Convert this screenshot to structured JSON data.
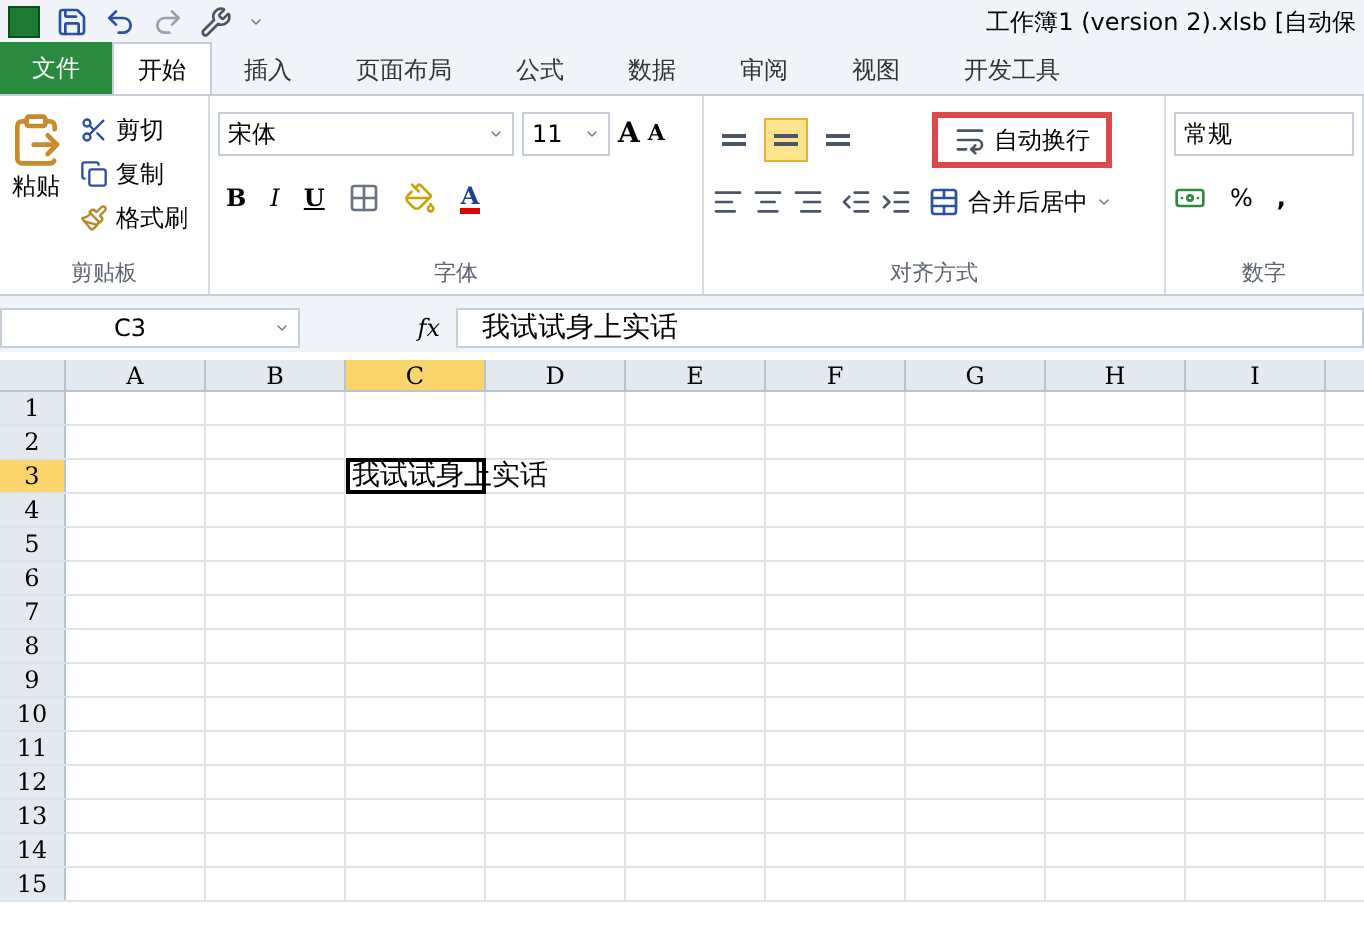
{
  "window": {
    "title": "工作簿1 (version 2).xlsb [自动保"
  },
  "tabs": [
    {
      "label": "文件",
      "kind": "file",
      "selected": false
    },
    {
      "label": "开始",
      "kind": "tab",
      "selected": true
    },
    {
      "label": "插入",
      "kind": "tab",
      "selected": false
    },
    {
      "label": "页面布局",
      "kind": "tab",
      "selected": false
    },
    {
      "label": "公式",
      "kind": "tab",
      "selected": false
    },
    {
      "label": "数据",
      "kind": "tab",
      "selected": false
    },
    {
      "label": "审阅",
      "kind": "tab",
      "selected": false
    },
    {
      "label": "视图",
      "kind": "tab",
      "selected": false
    },
    {
      "label": "开发工具",
      "kind": "tab",
      "selected": false
    }
  ],
  "clipboard": {
    "paste": "粘贴",
    "cut": "剪切",
    "copy": "复制",
    "format_painter": "格式刷",
    "group": "剪贴板"
  },
  "font": {
    "name": "宋体",
    "size": "11",
    "grow": "A",
    "shrink": "A",
    "bold": "B",
    "italic": "I",
    "underline": "U",
    "font_color": "A",
    "group": "字体"
  },
  "alignment": {
    "wrap_text": {
      "label": "自动换行",
      "highlighted": true
    },
    "merge": "合并后居中",
    "vertical": [
      {
        "selected": false
      },
      {
        "selected": true
      },
      {
        "selected": false
      }
    ],
    "group": "对齐方式"
  },
  "number": {
    "format": "常规",
    "percent": "%",
    "comma": ",",
    "group": "数字"
  },
  "formula_bar": {
    "name_box": "C3",
    "fx": "fx",
    "value": "我试试身上实话"
  },
  "sheet": {
    "columns": [
      {
        "label": "A",
        "selected": false
      },
      {
        "label": "B",
        "selected": false
      },
      {
        "label": "C",
        "selected": true
      },
      {
        "label": "D",
        "selected": false
      },
      {
        "label": "E",
        "selected": false
      },
      {
        "label": "F",
        "selected": false
      },
      {
        "label": "G",
        "selected": false
      },
      {
        "label": "H",
        "selected": false
      },
      {
        "label": "I",
        "selected": false
      }
    ],
    "rows": [
      {
        "label": "1",
        "selected": false
      },
      {
        "label": "2",
        "selected": false
      },
      {
        "label": "3",
        "selected": true
      },
      {
        "label": "4",
        "selected": false
      },
      {
        "label": "5",
        "selected": false
      },
      {
        "label": "6",
        "selected": false
      },
      {
        "label": "7",
        "selected": false
      },
      {
        "label": "8",
        "selected": false
      },
      {
        "label": "9",
        "selected": false
      },
      {
        "label": "10",
        "selected": false
      },
      {
        "label": "11",
        "selected": false
      },
      {
        "label": "12",
        "selected": false
      },
      {
        "label": "13",
        "selected": false
      },
      {
        "label": "14",
        "selected": false
      },
      {
        "label": "15",
        "selected": false
      }
    ],
    "active_cell_value": "我试试身上实话"
  }
}
